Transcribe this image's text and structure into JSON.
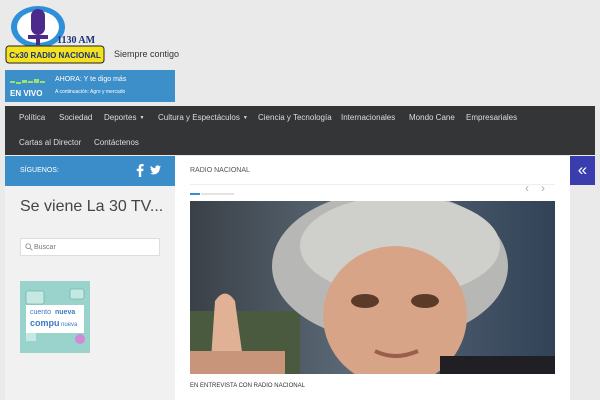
{
  "header": {
    "logo_frequency": "1130 AM",
    "logo_name": "Cx30 RADIO NACIONAL",
    "tagline": "Siempre contigo"
  },
  "live": {
    "badge": "EN VIVO",
    "now_playing": "AHORA: Y te digo más",
    "next": "A continuación: Agro y mercado"
  },
  "nav": {
    "items": [
      {
        "label": "Política"
      },
      {
        "label": "Sociedad"
      },
      {
        "label": "Deportes"
      },
      {
        "label": "Cultura y Espectáculos"
      },
      {
        "label": "Ciencia y Tecnología"
      },
      {
        "label": "Internacionales"
      },
      {
        "label": "Mondo Cane"
      },
      {
        "label": "Empresariales"
      },
      {
        "label": "Cartas al Director"
      },
      {
        "label": "Contáctenos"
      }
    ]
  },
  "sidebar": {
    "follow_label": "SÍGUENOS:",
    "title": "Se viene La 30 TV...",
    "search_placeholder": "Buscar",
    "banner_line1": "cuento",
    "banner_line2": "nueva",
    "banner_line3": "compu",
    "banner_line4": "nueva"
  },
  "main": {
    "category": "RADIO NACIONAL",
    "caption": "EN ENTREVISTA CON RADIO NACIONAL"
  },
  "icons": {
    "collapse": "double-chevron-left-icon",
    "facebook": "facebook-icon",
    "twitter": "twitter-icon",
    "search": "search-icon"
  },
  "colors": {
    "accent": "#3b8dca",
    "nav_bg": "#333537",
    "collapse_bg": "#3a3dad"
  }
}
